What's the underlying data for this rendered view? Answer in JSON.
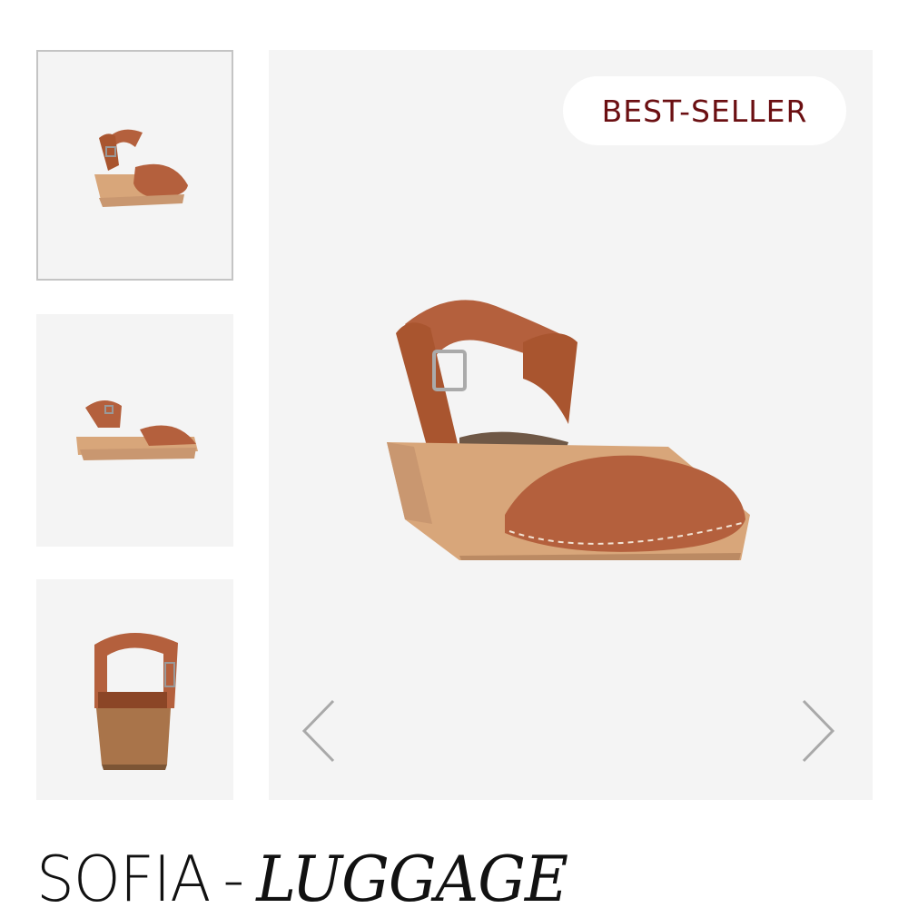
{
  "product": {
    "name": "SOFIA",
    "separator": "-",
    "variant": "LUGGAGE",
    "badge": "BEST-SELLER"
  },
  "gallery": {
    "thumbnails": [
      {
        "view": "three-quarter",
        "selected": true
      },
      {
        "view": "side",
        "selected": false
      },
      {
        "view": "back",
        "selected": false
      }
    ],
    "main_view": "three-quarter",
    "prev_icon": "chevron-left-icon",
    "next_icon": "chevron-right-icon"
  },
  "colors": {
    "leather": "#b4603d",
    "wood": "#d8a67a",
    "badge_text": "#6b0f12",
    "panel_bg": "#f4f4f4"
  }
}
